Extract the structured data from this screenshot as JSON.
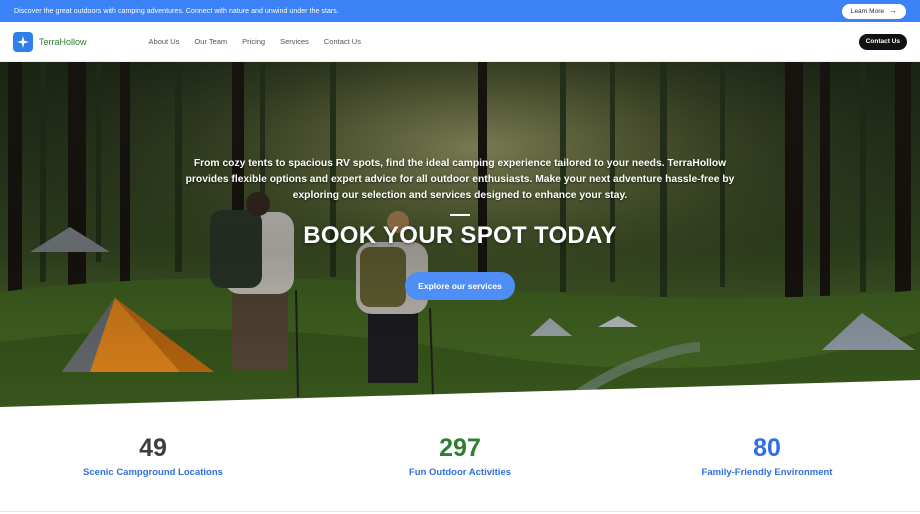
{
  "topbar": {
    "message": "Discover the great outdoors with camping adventures. Connect with nature and unwind under the stars.",
    "learn_more": "Learn More",
    "arrow_icon": "arrow-right-icon"
  },
  "navbar": {
    "brand": "TerraHollow",
    "links": [
      "About Us",
      "Our Team",
      "Pricing",
      "Services",
      "Contact Us"
    ],
    "cta": "Contact Us"
  },
  "hero": {
    "paragraph": "From cozy tents to spacious RV spots, find the ideal camping experience tailored to your needs. TerraHollow provides flexible options and expert advice for all outdoor enthusiasts. Make your next adventure hassle-free by exploring our selection and services designed to enhance your stay.",
    "heading": "BOOK YOUR SPOT TODAY",
    "button": "Explore our services"
  },
  "stats": [
    {
      "value": "49",
      "label": "Scenic Campground Locations",
      "color": "#3f3f3f"
    },
    {
      "value": "297",
      "label": "Fun Outdoor Activities",
      "color": "#2e7d32"
    },
    {
      "value": "80",
      "label": "Family-Friendly Environment",
      "color": "#2f6fde"
    }
  ],
  "colors": {
    "topbar": "#3b82f6",
    "button": "#4f8ef7",
    "brand_green": "#2e7d32",
    "link_blue": "#2f6fde"
  }
}
